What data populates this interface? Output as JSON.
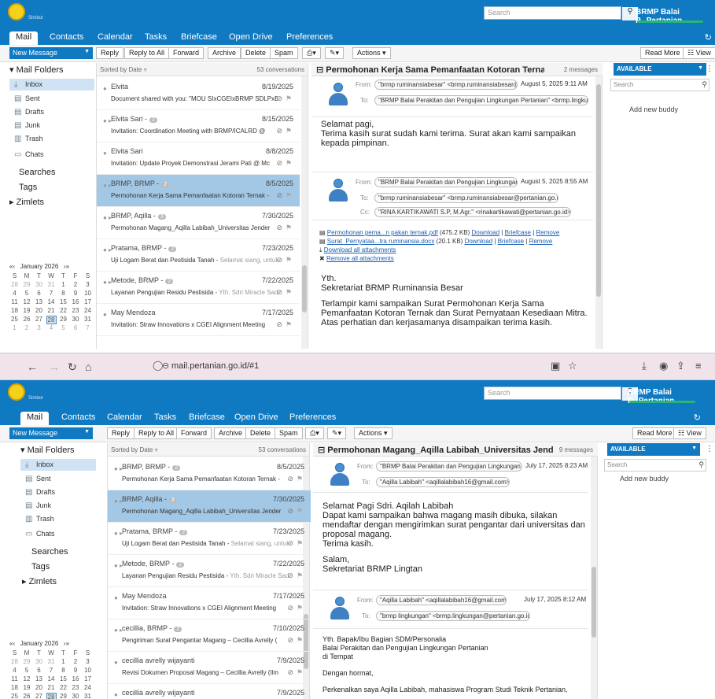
{
  "header": {
    "logo_sub": "Simbor",
    "search_placeholder": "Search",
    "search_icon": "search-icon",
    "user": "BRMP Balai P...Pertanian"
  },
  "tabs": [
    "Mail",
    "Contacts",
    "Calendar",
    "Tasks",
    "Briefcase",
    "Open Drive",
    "Preferences"
  ],
  "toolbar": {
    "new_message": "New Message",
    "reply": "Reply",
    "reply_all": "Reply to All",
    "forward": "Forward",
    "archive": "Archive",
    "delete": "Delete",
    "spam": "Spam",
    "actions": "Actions",
    "read_more": "Read More",
    "view": "View"
  },
  "sidebar": {
    "mail_folders": "Mail Folders",
    "folders": [
      "Inbox",
      "Sent",
      "Drafts",
      "Junk",
      "Trash",
      "Chats"
    ],
    "searches": "Searches",
    "tags": "Tags",
    "zimlets": "Zimlets"
  },
  "calendar": {
    "month": "January 2026",
    "days": [
      "S",
      "M",
      "T",
      "W",
      "T",
      "F",
      "S"
    ],
    "weeks": [
      [
        "28",
        "29",
        "30",
        "31",
        "1",
        "2",
        "3"
      ],
      [
        "4",
        "5",
        "6",
        "7",
        "8",
        "9",
        "10"
      ],
      [
        "11",
        "12",
        "13",
        "14",
        "15",
        "16",
        "17"
      ],
      [
        "18",
        "19",
        "20",
        "21",
        "22",
        "23",
        "24"
      ],
      [
        "25",
        "26",
        "27",
        "28",
        "29",
        "30",
        "31"
      ],
      [
        "1",
        "2",
        "3",
        "4",
        "5",
        "6",
        "7"
      ]
    ],
    "today": "28"
  },
  "list": {
    "sort": "Sorted by Date",
    "count": "53 conversations"
  },
  "top": {
    "messages": [
      {
        "from": "Elvita",
        "date": "8/19/2025",
        "subject": "Document shared with you: \"MOU SIxCGEIxBRMP SDLPxBRM",
        "fragment": ""
      },
      {
        "from": "Elvita Sari -",
        "badge": "2",
        "date": "8/15/2025",
        "subject": "Invitation: Coordination Meeting with BRMP/ICALRD @",
        "fragment": ""
      },
      {
        "from": "Elvita Sari",
        "date": "8/8/2025",
        "subject": "Invitation: Update Proyek Demonstrasi Jerami Pati @ Mc",
        "fragment": ""
      },
      {
        "from": "BRMP, BRMP -",
        "badge": "2",
        "date": "8/5/2025",
        "subject": "Permohonan Kerja Sama Pemanfaatan Kotoran Ternak -",
        "fragment": ""
      },
      {
        "from": "BRMP, Aqilla -",
        "badge": "3",
        "date": "7/30/2025",
        "subject": "Permohonan Magang_Aqilla Labibah_Universitas Jender",
        "fragment": ""
      },
      {
        "from": "Pratama, BRMP -",
        "badge": "2",
        "date": "7/23/2025",
        "subject": "Uji Logam Berat dan Pestisida Tanah - ",
        "fragment": "Selamat siang, untuk si"
      },
      {
        "from": "Metode, BRMP -",
        "badge": "2",
        "date": "7/22/2025",
        "subject": "Layanan Pengujian Residu Pestisida - ",
        "fragment": "Yth. Sdri Miracle Sadrini"
      },
      {
        "from": "May Mendoza",
        "date": "7/17/2025",
        "subject": "Invitation: Straw Innovations x CGEI Alignment Meeting",
        "fragment": ""
      }
    ],
    "reader": {
      "title": "Permohonan Kerja Sama Pemanfaatan Kotoran Ternak",
      "count": "2 messages",
      "m1": {
        "from_label": "From:",
        "from": "\"brmp ruminansiabesar\" <brmp.ruminansiabesar@p",
        "date": "August 5, 2025 9:11 AM",
        "to_label": "To:",
        "to": "\"BRMP Balai Perakitan dan Pengujian Lingkungan Pertanian\" <brmp.lingkung",
        "body": [
          "Selamat pagi,",
          "Terima kasih surat sudah kami terima. Surat akan kami sampaikan",
          "kepada pimpinan."
        ]
      },
      "m2": {
        "from_label": "From:",
        "from": "\"BRMP Balai Perakitan dan Pengujian Lingkungan Pe",
        "date": "August 5, 2025 8:55 AM",
        "to_label": "To:",
        "to": "\"brmp ruminansiabesar\" <brmp.ruminansiabesar@pertanian.go.id>",
        "cc_label": "Cc:",
        "cc": "\"RINA KARTIKAWATI S.P, M.Agr.\" <rinakartikawati@pertanian.go.id>",
        "att1_name": "Permohonan pema...n pakan ternak.pdf",
        "att1_size": "(475.2 KB)",
        "att2_name": "Surat_Pernyataa...tra ruminansia.docx",
        "att2_size": "(20.1 KB)",
        "download": "Download",
        "briefcase": "Briefcase",
        "remove": "Remove",
        "download_all": "Download all attachments",
        "remove_all": "Remove all attachments",
        "body": [
          "Yth.",
          "Sekretariat BRMP Ruminansia Besar",
          "",
          "Terlampir kami sampaikan Surat Permohonan Kerja Sama",
          "Pemanfaatan Kotoran Ternak dan Surat Pernyataan Kesediaan Mitra.",
          "Atas perhatian dan kerjasamanya disampaikan terima kasih."
        ]
      }
    }
  },
  "browser": {
    "url": "mail.pertanian.go.id/#1"
  },
  "bottom": {
    "messages": [
      {
        "from": "BRMP, BRMP -",
        "badge": "2",
        "date": "8/5/2025",
        "subject": "Permohonan Kerja Sama Pemanfaatan Kotoran Ternak -",
        "fragment": ""
      },
      {
        "from": "BRMP, Aqilla -",
        "badge": "3",
        "date": "7/30/2025",
        "subject": "Permohonan Magang_Aqilla Labibah_Universitas Jender",
        "fragment": ""
      },
      {
        "from": "Pratama, BRMP -",
        "badge": "2",
        "date": "7/23/2025",
        "subject": "Uji Logam Berat dan Pestisida Tanah - ",
        "fragment": "Selamat siang, untuk si"
      },
      {
        "from": "Metode, BRMP -",
        "badge": "2",
        "date": "7/22/2025",
        "subject": "Layanan Pengujian Residu Pestisida - ",
        "fragment": "Yth. Sdri Miracle Sadrini"
      },
      {
        "from": "May Mendoza",
        "date": "7/17/2025",
        "subject": "Invitation: Straw Innovations x CGEI Alignment Meeting",
        "fragment": ""
      },
      {
        "from": "cecillia, BRMP -",
        "badge": "2",
        "date": "7/10/2025",
        "subject": "Pengiriman Surat Pengantar Magang – Cecillia Avrelly (",
        "fragment": ""
      },
      {
        "from": "cecillia avrelly wijayanti",
        "date": "7/9/2025",
        "subject": "Revisi Dokumen Proposal Magang – Cecillia Avrelly (Ilm",
        "fragment": ""
      },
      {
        "from": "cecillia avrelly wijayanti",
        "date": "7/9/2025",
        "subject": "Pengiriman Proposal Magang – Cecillia Avrelly Wijayanti",
        "fragment": ""
      }
    ],
    "reader": {
      "title": "Permohonan Magang_Aqilla Labibah_Universitas Jenderal Sc",
      "count": "9 messages",
      "m1": {
        "from_label": "From:",
        "from": "\"BRMP Balai Perakitan dan Pengujian Lingkungan Pert",
        "date": "July 17, 2025 8:23 AM",
        "to_label": "To:",
        "to": "\"Aqilla Labibah\" <aqillalabibah16@gmail.com>",
        "body": [
          "Selamat Pagi Sdri. Aqilah Labibah",
          "Dapat kami sampaikan bahwa magang masih dibuka, silakan",
          "mendaftar dengan mengirimkan surat pengantar dari universitas dan",
          "proposal magang.",
          "Terima kasih.",
          "",
          "Salam,",
          "Sekretariat BRMP Lingtan"
        ]
      },
      "m2": {
        "from_label": "From:",
        "from": "\"Aqilla Labibah\" <aqillalabibah16@gmail.com>",
        "date": "July 17, 2025 8:12 AM",
        "to_label": "To:",
        "to": "\"brmp lingkungan\" <brmp.lingkungan@pertanian.go.id>",
        "body": [
          "Yth. Bapak/Ibu Bagian SDM/Personalia",
          "Balai Perakitan dan Pengujian Lingkungan Pertanian",
          "di Tempat",
          "",
          "Dengan hormat,",
          "",
          "Perkenalkan saya Aqilla Labibah, mahasiswa Program Studi Teknik Pertanian,"
        ]
      }
    }
  },
  "right_panel": {
    "available": "AVAILABLE",
    "search_placeholder": "Search",
    "add_buddy": "Add new buddy"
  },
  "colors": {
    "brand_blue": "#0f7ac2",
    "selected_row": "#a3c8e6",
    "browser_bar": "#f1e3ea"
  }
}
